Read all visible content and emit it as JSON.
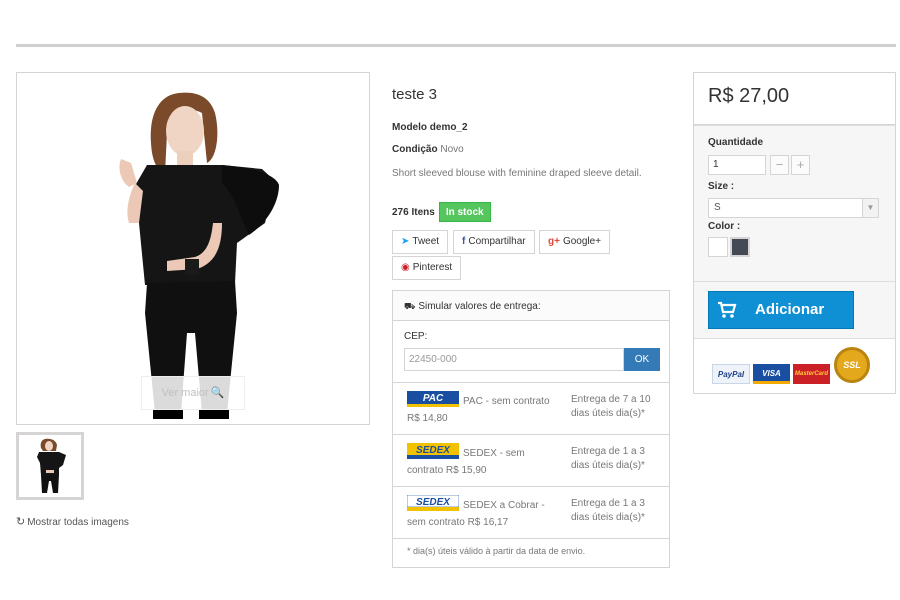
{
  "product": {
    "title": "teste 3",
    "model_label": "Modelo",
    "model_value": "demo_2",
    "condition_label": "Condição",
    "condition_value": "Novo",
    "description": "Short sleeved blouse with feminine draped sleeve detail.",
    "quantity_items": "276 Itens",
    "stock_badge": "In stock"
  },
  "gallery": {
    "zoom_label": "Ver maior",
    "show_all_label": "Mostrar todas imagens"
  },
  "share": {
    "tweet": "Tweet",
    "facebook": "Compartilhar",
    "googleplus": "Google+",
    "pinterest": "Pinterest"
  },
  "shipping": {
    "header": "Simular valores de entrega:",
    "cep_label": "CEP:",
    "cep_value": "22450-000",
    "ok_label": "OK",
    "options": [
      {
        "logo": "PAC",
        "name": "PAC - sem contrato R$ 14,80",
        "eta": "Entrega de 7 a 10 dias úteis dia(s)*"
      },
      {
        "logo": "SEDEX",
        "name": "SEDEX - sem contrato R$ 15,90",
        "eta": "Entrega de 1 a 3 dias úteis dia(s)*"
      },
      {
        "logo": "SEDEX",
        "name": "SEDEX a Cobrar - sem contrato R$ 16,17",
        "eta": "Entrega de 1 a 3 dias úteis dia(s)*"
      }
    ],
    "footnote": "* dia(s) úteis válido à partir da data de envio."
  },
  "buybox": {
    "price": "R$ 27,00",
    "quantity_label": "Quantidade",
    "quantity_value": "1",
    "size_label": "Size :",
    "size_value": "S",
    "color_label": "Color :",
    "colors": [
      "#ffffff",
      "#434a54"
    ],
    "add_label": "Adicionar",
    "payments": [
      "PayPal",
      "VISA",
      "MasterCard",
      "SSL"
    ]
  },
  "colors": {
    "accent": "#0f8fd4",
    "ok_button": "#337ab7",
    "in_stock": "#55c65e"
  }
}
